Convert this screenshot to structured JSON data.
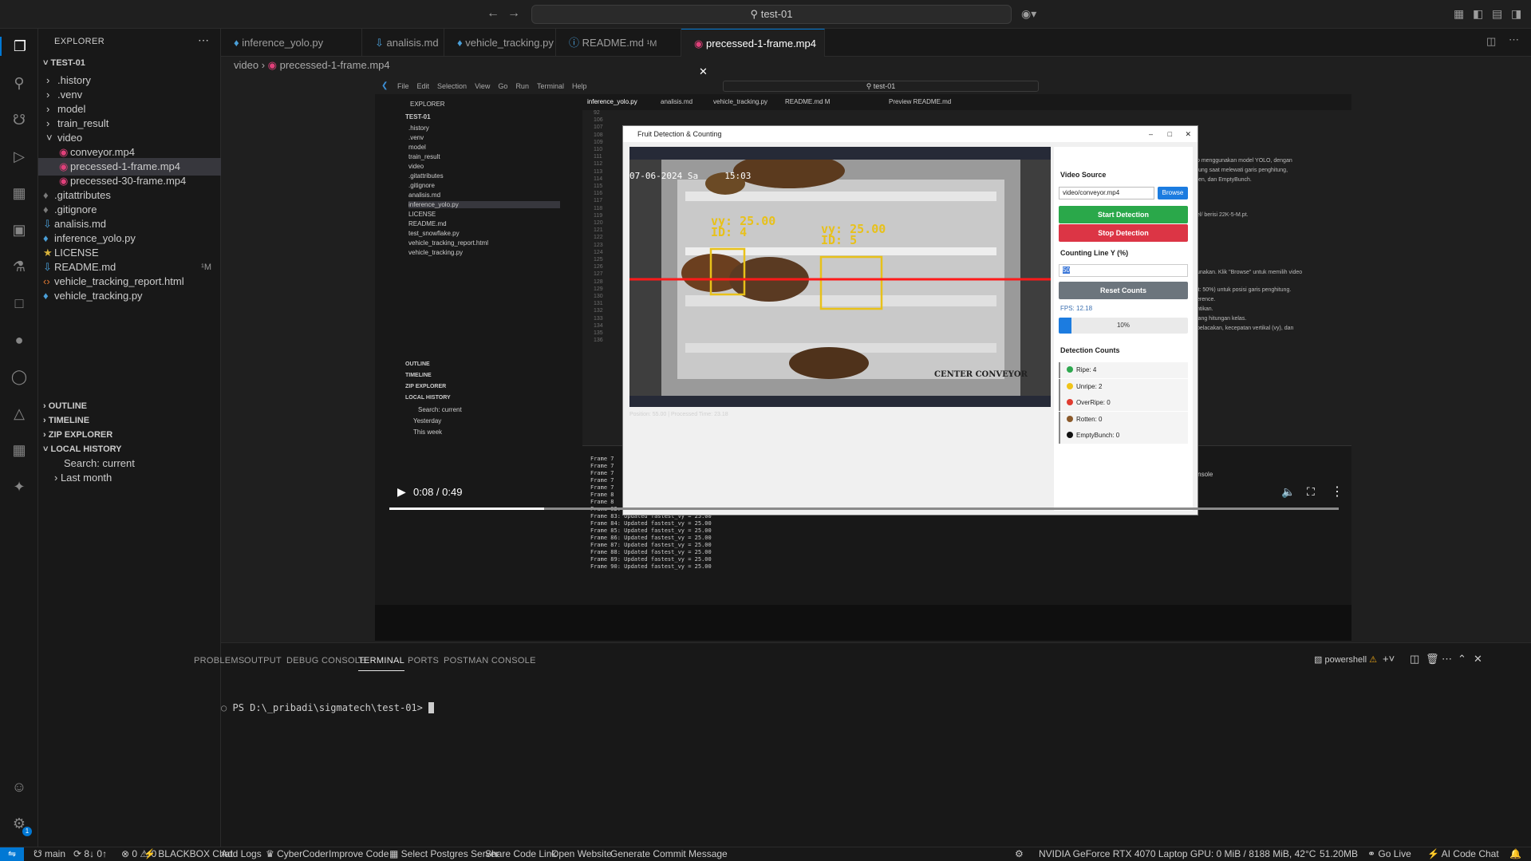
{
  "titlebar": {
    "search": "test-01"
  },
  "sidebar": {
    "title": "EXPLORER",
    "root": "TEST-01",
    "items": [
      {
        "label": ".history",
        "type": "folder"
      },
      {
        "label": ".venv",
        "type": "folder"
      },
      {
        "label": "model",
        "type": "folder"
      },
      {
        "label": "train_result",
        "type": "folder"
      },
      {
        "label": "video",
        "type": "folder-open"
      },
      {
        "label": "conveyor.mp4",
        "type": "video"
      },
      {
        "label": "precessed-1-frame.mp4",
        "type": "video"
      },
      {
        "label": "precessed-30-frame.mp4",
        "type": "video"
      },
      {
        "label": ".gitattributes",
        "type": "git"
      },
      {
        "label": ".gitignore",
        "type": "git"
      },
      {
        "label": "analisis.md",
        "type": "md"
      },
      {
        "label": "inference_yolo.py",
        "type": "py"
      },
      {
        "label": "LICENSE",
        "type": "license"
      },
      {
        "label": "README.md",
        "type": "md",
        "badge": "¹M"
      },
      {
        "label": "vehicle_tracking_report.html",
        "type": "html"
      },
      {
        "label": "vehicle_tracking.py",
        "type": "py"
      }
    ],
    "sections": [
      "OUTLINE",
      "TIMELINE",
      "ZIP EXPLORER",
      "LOCAL HISTORY"
    ],
    "history": {
      "search": "Search: current",
      "group": "Last month"
    }
  },
  "tabs": [
    {
      "label": "inference_yolo.py"
    },
    {
      "label": "analisis.md"
    },
    {
      "label": "vehicle_tracking.py"
    },
    {
      "label": "README.md",
      "badge": "¹M"
    },
    {
      "label": "precessed-1-frame.mp4",
      "active": true
    }
  ],
  "breadcrumb": {
    "folder": "video",
    "file": "precessed-1-frame.mp4"
  },
  "inner": {
    "menu": [
      "File",
      "Edit",
      "Selection",
      "View",
      "Go",
      "Run",
      "Terminal",
      "Help"
    ],
    "search": "test-01",
    "explorer": "EXPLORER",
    "root": "TEST-01",
    "files": [
      ".history",
      ".venv",
      "model",
      "train_result",
      "video",
      ".gitattributes",
      ".gitignore",
      "analisis.md",
      "inference_yolo.py",
      "LICENSE",
      "README.md",
      "test_snowflake.py",
      "vehicle_tracking_report.html",
      "vehicle_tracking.py"
    ],
    "sections": [
      "OUTLINE",
      "TIMELINE",
      "ZIP EXPLORER",
      "LOCAL HISTORY"
    ],
    "history": [
      "Search: current",
      "Yesterday",
      "This week"
    ],
    "tabs": [
      "inference_yolo.py",
      "analisis.md",
      "vehicle_tracking.py",
      "README.md M",
      "Preview README.md"
    ],
    "lines": [
      "92",
      "106",
      "107",
      "108",
      "109",
      "110",
      "111",
      "112",
      "113",
      "114",
      "115",
      "116",
      "117",
      "118",
      "119",
      "120",
      "121",
      "122",
      "123",
      "124",
      "125",
      "126",
      "127",
      "128",
      "129",
      "130",
      "131",
      "132",
      "133",
      "134",
      "135",
      "136"
    ],
    "terminal": [
      "Frame 7",
      "Frame 7",
      "Frame 7",
      "Frame 7",
      "Frame 7",
      "Frame 8",
      "Frame 8",
      "Frame 82: Updated fastest_vy = 25.00",
      "Frame 83: Updated fastest_vy = 25.00",
      "Frame 84: Updated fastest_vy = 25.00",
      "Frame 85: Updated fastest_vy = 25.00",
      "Frame 86: Updated fastest_vy = 25.00",
      "Frame 87: Updated fastest_vy = 25.00",
      "Frame 88: Updated fastest_vy = 25.00",
      "Frame 89: Updated fastest_vy = 25.00",
      "Frame 90: Updated fastest_vy = 25.00"
    ],
    "readme": [
      "o menggunakan model YOLO, dengan",
      "tung saat melewati garis penghitung,",
      "ten, dan EmptyBunch.",
      "el/ berisi 22K-5-M.pt.",
      "unakan. Klik \"Browse\" untuk memilih video",
      "lt: 50%) untuk posisi garis penghitung.",
      "erence.",
      "ntikan.",
      "lang hitungan kelas.",
      "pelacakan, kecepatan vertikal (vy), dan"
    ],
    "terminals": [
      "powershell",
      "Python Debug Console"
    ]
  },
  "app": {
    "title": "Fruit Detection & Counting",
    "timestamp": "07-06-2024 Sa     15:03",
    "detections": [
      {
        "label": "vy: 25.00\nID: 4"
      },
      {
        "label": "vy: 25.00\nID: 5"
      }
    ],
    "watermark": "CENTER CONVEYOR",
    "status_line": "Position: 55.00  |  Processed Time: 23.18",
    "video_source_label": "Video Source",
    "path_value": "video/conveyor.mp4",
    "browse": "Browse",
    "start": "Start Detection",
    "stop": "Stop Detection",
    "counting_label": "Counting Line Y (%)",
    "counting_value": "50",
    "reset": "Reset Counts",
    "fps": "FPS: 12.18",
    "progress_text": "10%",
    "progress": 0.1,
    "counts_title": "Detection Counts",
    "counts": [
      {
        "label": "Ripe: 4",
        "color": "#2ea84f"
      },
      {
        "label": "Unripe: 2",
        "color": "#f0c419"
      },
      {
        "label": "OverRipe: 0",
        "color": "#e03c31"
      },
      {
        "label": "Rotten: 0",
        "color": "#8b5a2b"
      },
      {
        "label": "EmptyBunch: 0",
        "color": "#111111"
      }
    ]
  },
  "player": {
    "time": "0:08 / 0:49",
    "progress": 0.163
  },
  "panel": {
    "tabs": [
      "PROBLEMS",
      "OUTPUT",
      "DEBUG CONSOLE",
      "TERMINAL",
      "PORTS",
      "POSTMAN CONSOLE"
    ],
    "active_tab": "TERMINAL",
    "shell": "powershell",
    "prompt": "PS D:\\_pribadi\\sigmatech\\test-01> "
  },
  "status": {
    "branch": "main",
    "sync": "8↓ 0↑",
    "problems": "0",
    "warnings": "0",
    "items": [
      "BLACKBOX Chat",
      "Add Logs",
      "CyberCoder",
      "Improve Code",
      "Select Postgres Server",
      "Share Code Link",
      "Open Website",
      "Generate Commit Message"
    ],
    "gpu": "NVIDIA GeForce RTX 4070 Laptop GPU: 0 MiB / 8188 MiB, 42°C",
    "mem": "51.20MB",
    "golive": "Go Live",
    "aichat": "AI Code Chat"
  }
}
